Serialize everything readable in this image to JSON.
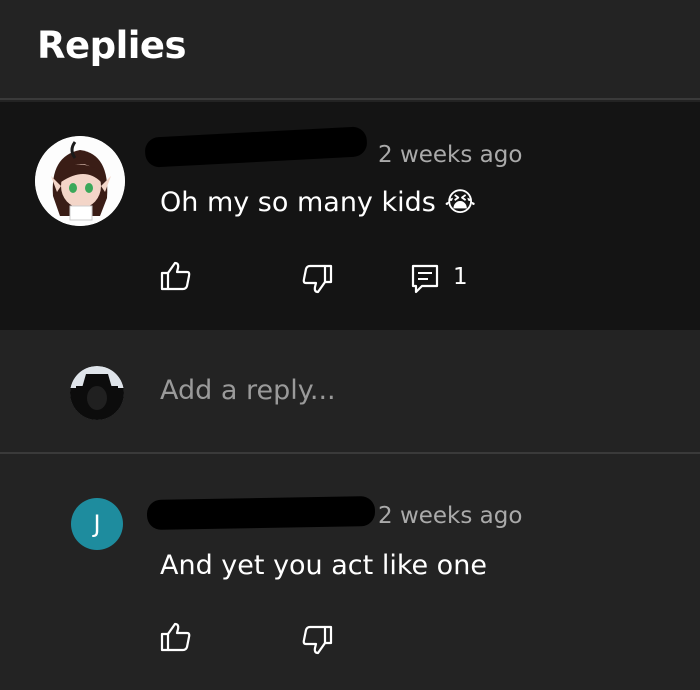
{
  "header": {
    "title": "Replies"
  },
  "comment": {
    "timestamp": "2 weeks ago",
    "text": "Oh my so many kids 😭",
    "reply_count": "1"
  },
  "add_reply": {
    "placeholder": "Add a reply..."
  },
  "reply": {
    "avatar_letter": "J",
    "timestamp": "2 weeks ago",
    "text": "And yet you act like one"
  },
  "colors": {
    "background": "#232323",
    "highlighted_comment": "#141414",
    "avatar_teal": "#1e8c9e",
    "muted_text": "#aaaaaa"
  }
}
